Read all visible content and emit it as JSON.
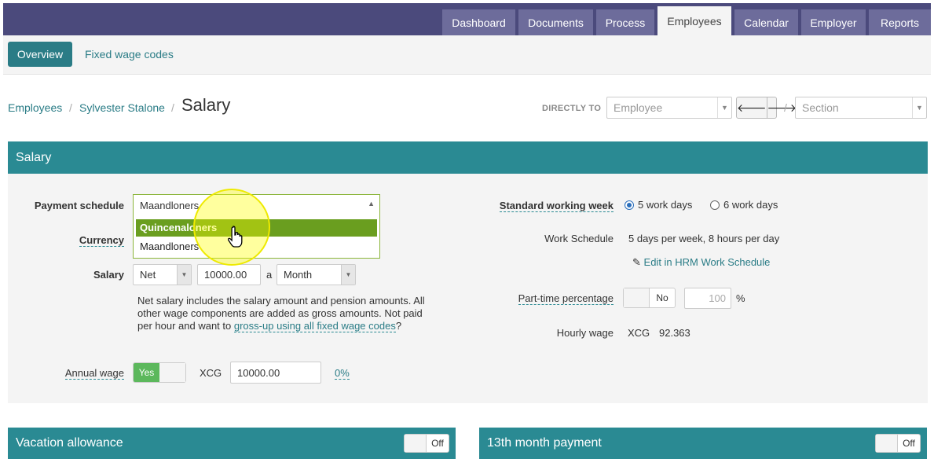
{
  "topnav": {
    "items": [
      "Dashboard",
      "Documents",
      "Process",
      "Employees",
      "Calendar",
      "Employer",
      "Reports"
    ],
    "active": "Employees"
  },
  "subnav": {
    "overview": "Overview",
    "fixed_wage_codes": "Fixed wage codes"
  },
  "breadcrumb": {
    "employees": "Employees",
    "person": "Sylvester Stalone",
    "title": "Salary",
    "separator": "/"
  },
  "directly_to": {
    "label": "DIRECTLY TO",
    "employee_placeholder": "Employee",
    "section_placeholder": "Section",
    "slash": "/"
  },
  "salary_panel": {
    "title": "Salary",
    "payment_schedule": {
      "label": "Payment schedule",
      "value": "Maandloners",
      "options": [
        "Quincenaloners",
        "Maandloners"
      ],
      "highlighted": "Quincenaloners"
    },
    "currency": {
      "label": "Currency"
    },
    "salary": {
      "label": "Salary",
      "type": "Net",
      "amount": "10000.00",
      "a": "a",
      "period": "Month"
    },
    "note": {
      "text": "Net salary includes the salary amount and pension amounts. All other wage components are added as gross amounts. Not paid per hour and want to",
      "link": "gross-up using all fixed wage codes",
      "end": "?"
    },
    "annual_wage": {
      "label": "Annual wage",
      "toggle": "Yes",
      "currency": "XCG",
      "value": "10000.00",
      "percent": "0%"
    },
    "standard_week": {
      "label": "Standard working week",
      "option1": "5 work days",
      "option2": "6 work days",
      "selected": "5 work days"
    },
    "work_schedule": {
      "label": "Work Schedule",
      "value": "5 days per week, 8 hours per day",
      "edit": "Edit in HRM Work Schedule"
    },
    "part_time": {
      "label": "Part-time percentage",
      "toggle": "No",
      "placeholder": "100",
      "unit": "%"
    },
    "hourly_wage": {
      "label": "Hourly wage",
      "currency": "XCG",
      "value": "92.363"
    }
  },
  "vacation": {
    "title": "Vacation allowance",
    "toggle": "Off"
  },
  "thirteenth": {
    "title": "13th month payment",
    "toggle": "Off"
  },
  "colors": {
    "header": "#4b4a7c",
    "teal": "#2a8a93",
    "green": "#6a9e1f",
    "highlight": "#ffff00"
  },
  "icons": [
    "arrow-left-icon",
    "arrow-right-icon",
    "pencil-icon",
    "hand-cursor-icon",
    "caret-down-icon"
  ]
}
